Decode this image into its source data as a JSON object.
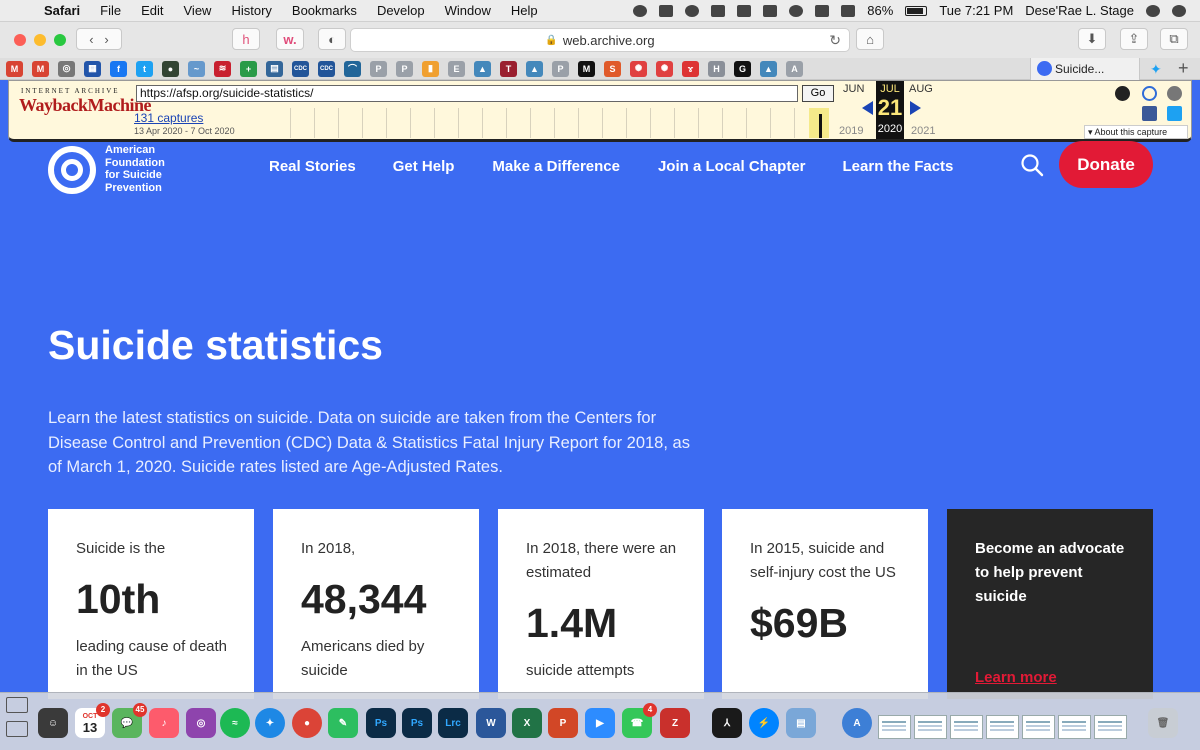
{
  "menubar": {
    "app": "Safari",
    "items": [
      "File",
      "Edit",
      "View",
      "History",
      "Bookmarks",
      "Develop",
      "Window",
      "Help"
    ],
    "battery": "86%",
    "clock": "Tue 7:21 PM",
    "user": "Dese'Rae L. Stage"
  },
  "browser": {
    "address": "web.archive.org",
    "active_tab": "Suicide..."
  },
  "favorites": [
    {
      "icon": "gmail-icon",
      "label": "M",
      "color": "#d84433"
    },
    {
      "icon": "gmail-icon",
      "label": "M",
      "color": "#d84433"
    },
    {
      "icon": "compass-icon",
      "label": "◎",
      "color": "#777777"
    },
    {
      "icon": "grid-icon",
      "label": "▦",
      "color": "#2255aa"
    },
    {
      "icon": "facebook-icon",
      "label": "f",
      "color": "#1877f2"
    },
    {
      "icon": "twitter-icon",
      "label": "t",
      "color": "#1da1f2"
    },
    {
      "icon": "spy-icon",
      "label": "●",
      "color": "#334433"
    },
    {
      "icon": "bird-icon",
      "label": "~",
      "color": "#6699cc"
    },
    {
      "icon": "bank-icon",
      "label": "≋",
      "color": "#c8202f"
    },
    {
      "icon": "cross-icon",
      "label": "+",
      "color": "#2a9b48"
    },
    {
      "icon": "map-icon",
      "label": "▤",
      "color": "#336699"
    },
    {
      "icon": "cdc-icon",
      "label": "CDC",
      "color": "#225599"
    },
    {
      "icon": "cdc-icon",
      "label": "CDC",
      "color": "#225599"
    },
    {
      "icon": "bridge-icon",
      "label": "⌒",
      "color": "#226699"
    },
    {
      "icon": "p-icon",
      "label": "P",
      "color": "#9aa0a8"
    },
    {
      "icon": "p-icon",
      "label": "P",
      "color": "#9aa0a8"
    },
    {
      "icon": "bookmark-icon",
      "label": "▮",
      "color": "#f0a030"
    },
    {
      "icon": "e-icon",
      "label": "E",
      "color": "#9aa0a8"
    },
    {
      "icon": "photo-icon",
      "label": "▲",
      "color": "#4488bb"
    },
    {
      "icon": "t-icon",
      "label": "T",
      "color": "#9a1f2f"
    },
    {
      "icon": "landscape-icon",
      "label": "▲",
      "color": "#4488bb"
    },
    {
      "icon": "p-icon",
      "label": "P",
      "color": "#9aa0a8"
    },
    {
      "icon": "medium-icon",
      "label": "M",
      "color": "#111111"
    },
    {
      "icon": "s-icon",
      "label": "S",
      "color": "#e05a2a"
    },
    {
      "icon": "target-icon",
      "label": "✺",
      "color": "#e04040"
    },
    {
      "icon": "target-icon",
      "label": "✺",
      "color": "#e04040"
    },
    {
      "icon": "ribbon-icon",
      "label": "ɤ",
      "color": "#dd3333"
    },
    {
      "icon": "h-icon",
      "label": "H",
      "color": "#8a8f98"
    },
    {
      "icon": "g-icon",
      "label": "G",
      "color": "#111111"
    },
    {
      "icon": "image-icon",
      "label": "▲",
      "color": "#4488bb"
    },
    {
      "icon": "a-icon",
      "label": "A",
      "color": "#9aa0a8"
    }
  ],
  "wayback": {
    "logo_top": "INTERNET ARCHIVE",
    "logo": "WaybackMachine",
    "url": "https://afsp.org/suicide-statistics/",
    "go": "Go",
    "captures": "131 captures",
    "range": "13 Apr 2020 - 7 Oct 2020",
    "prev_month": "JUN",
    "cur_month": "JUL",
    "next_month": "AUG",
    "day": "21",
    "prev_year": "2019",
    "cur_year": "2020",
    "next_year": "2021",
    "about": "About this capture"
  },
  "site": {
    "logo_lines": [
      "American",
      "Foundation",
      "for Suicide",
      "Prevention"
    ],
    "nav": [
      "Real Stories",
      "Get Help",
      "Make a Difference",
      "Join a Local Chapter",
      "Learn the Facts"
    ],
    "donate": "Donate",
    "title": "Suicide statistics",
    "intro": "Learn the latest statistics on suicide. Data on suicide are taken from the Centers for Disease Control and Prevention (CDC) Data & Statistics Fatal Injury Report for 2018, as of March 1, 2020. Suicide rates listed are Age-Adjusted Rates.",
    "cards": [
      {
        "lead": "Suicide is the",
        "big": "10th",
        "tail": "leading cause of death in the US"
      },
      {
        "lead": "In 2018,",
        "big": "48,344",
        "tail": "Americans died by suicide"
      },
      {
        "lead": "In 2018, there were an estimated",
        "big": "1.4M",
        "tail": "suicide attempts"
      },
      {
        "lead": "In 2015, suicide and self-injury cost the US",
        "big": "$69B",
        "tail": ""
      }
    ],
    "cta": {
      "lead": "Become an advocate to help prevent suicide",
      "link": "Learn more"
    }
  },
  "dock": {
    "calendar_month": "OCT",
    "calendar_day": "13",
    "messages_badge": "45",
    "mail_badge": "2",
    "facetime_badge": "4"
  }
}
